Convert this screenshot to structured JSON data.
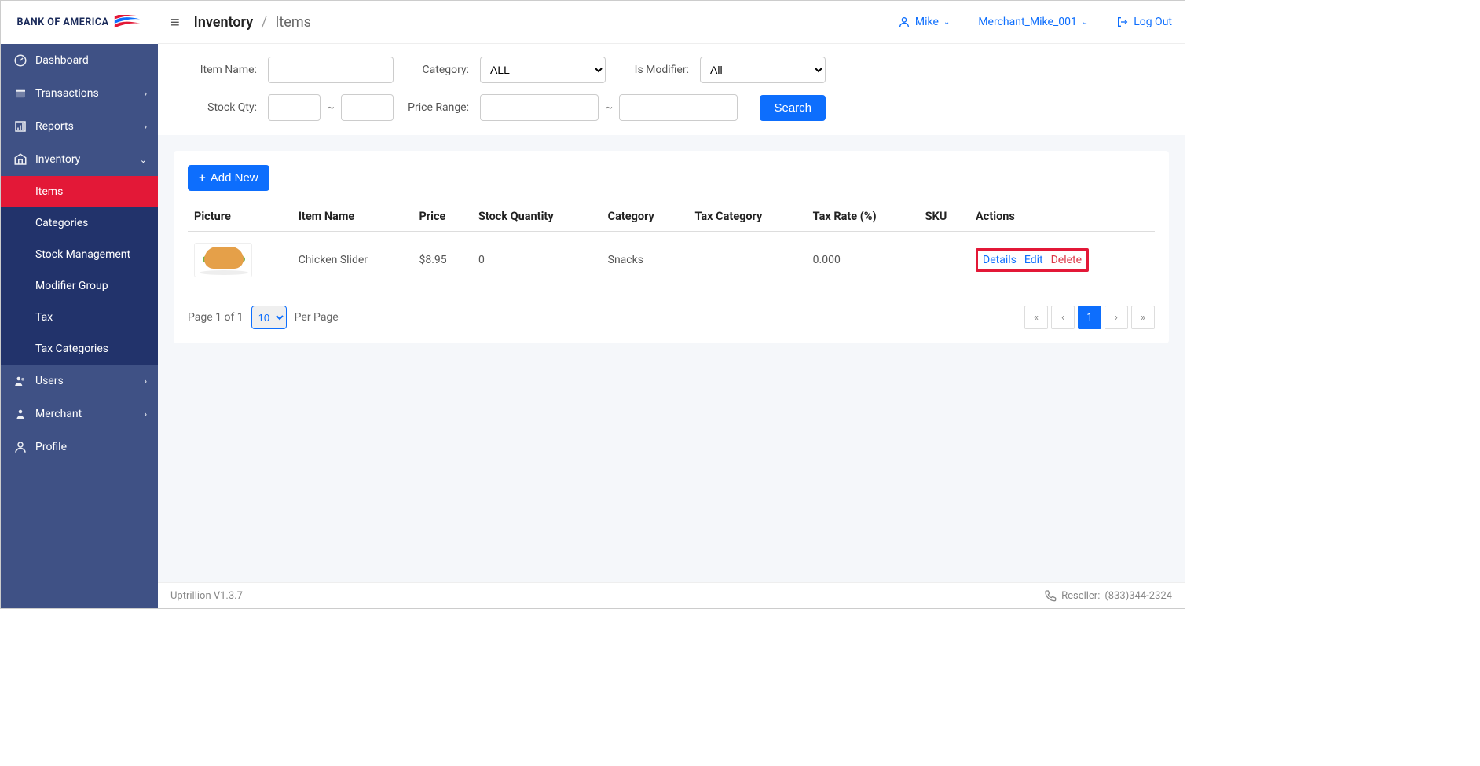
{
  "logo": {
    "text": "BANK OF AMERICA"
  },
  "sidebar": {
    "items": [
      {
        "label": "Dashboard",
        "icon": "dashboard"
      },
      {
        "label": "Transactions",
        "icon": "transactions",
        "expandable": true
      },
      {
        "label": "Reports",
        "icon": "reports",
        "expandable": true
      },
      {
        "label": "Inventory",
        "icon": "inventory",
        "expandable": true,
        "expanded": true
      },
      {
        "label": "Users",
        "icon": "users",
        "expandable": true
      },
      {
        "label": "Merchant",
        "icon": "merchant",
        "expandable": true
      },
      {
        "label": "Profile",
        "icon": "profile"
      }
    ],
    "inventory_sub": [
      {
        "label": "Items",
        "active": true
      },
      {
        "label": "Categories"
      },
      {
        "label": "Stock Management"
      },
      {
        "label": "Modifier Group"
      },
      {
        "label": "Tax"
      },
      {
        "label": "Tax Categories"
      }
    ]
  },
  "topbar": {
    "breadcrumb_main": "Inventory",
    "breadcrumb_sub": "Items",
    "user": "Mike",
    "merchant": "Merchant_Mike_001",
    "logout": "Log Out"
  },
  "filters": {
    "item_name_label": "Item Name:",
    "category_label": "Category:",
    "category_value": "ALL",
    "is_modifier_label": "Is Modifier:",
    "is_modifier_value": "All",
    "stock_qty_label": "Stock Qty:",
    "price_range_label": "Price Range:",
    "search_label": "Search"
  },
  "card": {
    "add_new_label": "Add New"
  },
  "table": {
    "columns": [
      "Picture",
      "Item Name",
      "Price",
      "Stock Quantity",
      "Category",
      "Tax Category",
      "Tax Rate (%)",
      "SKU",
      "Actions"
    ],
    "rows": [
      {
        "item_name": "Chicken Slider",
        "price": "$8.95",
        "stock_qty": "0",
        "category": "Snacks",
        "tax_category": "",
        "tax_rate": "0.000",
        "sku": "",
        "actions": {
          "details": "Details",
          "edit": "Edit",
          "delete": "Delete"
        }
      }
    ]
  },
  "pagination": {
    "page_info": "Page 1 of 1",
    "per_page": "10",
    "per_page_label": "Per Page",
    "current": "1"
  },
  "footer": {
    "version": "Uptrillion V1.3.7",
    "reseller_label": "Reseller:",
    "reseller_phone": "(833)344-2324"
  }
}
